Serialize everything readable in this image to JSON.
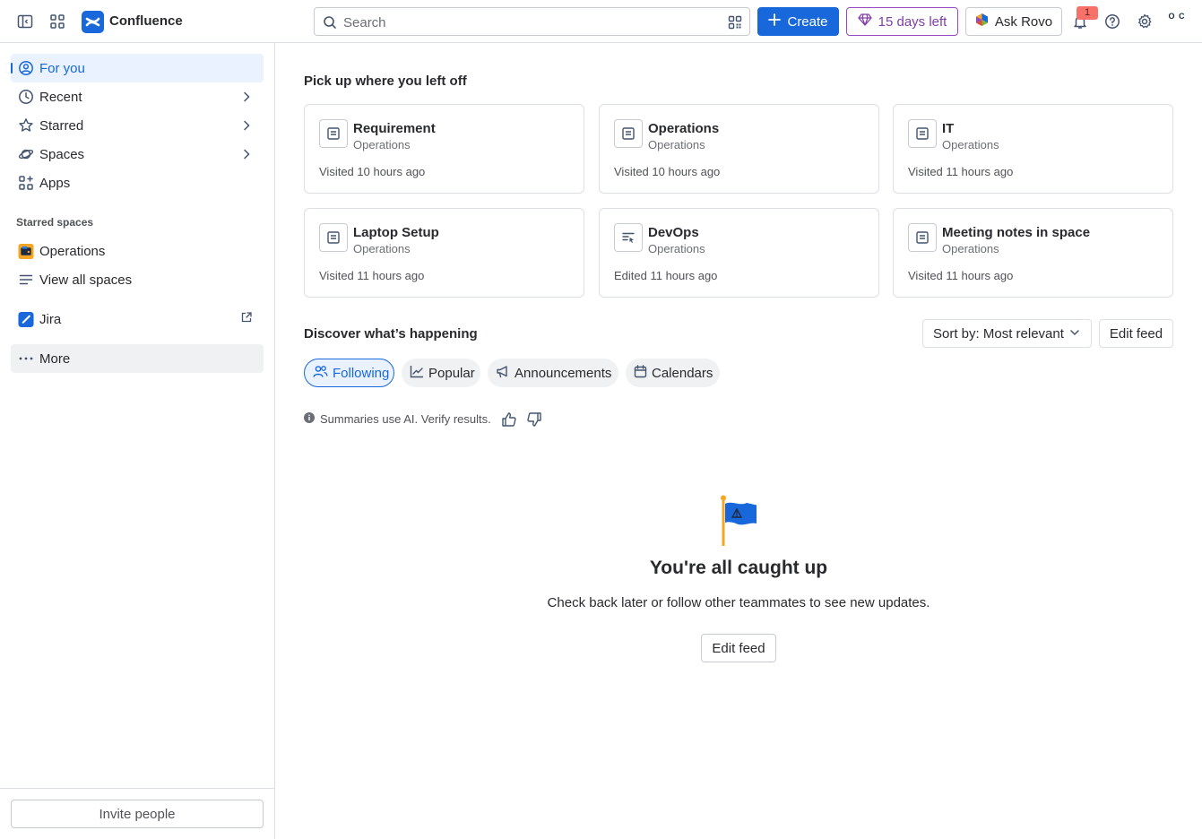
{
  "topbar": {
    "app_name": "Confluence",
    "search_placeholder": "Search",
    "create_label": "Create",
    "trial_label": "15 days left",
    "rovo_label": "Ask Rovo",
    "notification_count": "1",
    "avatar_initials": "O C"
  },
  "sidebar": {
    "items": [
      {
        "label": "For you",
        "icon": "user-circle-icon",
        "active": true
      },
      {
        "label": "Recent",
        "icon": "clock-icon"
      },
      {
        "label": "Starred",
        "icon": "star-icon"
      },
      {
        "label": "Spaces",
        "icon": "planet-icon"
      },
      {
        "label": "Apps",
        "icon": "apps-icon"
      }
    ],
    "starred_spaces_label": "Starred spaces",
    "starred_spaces": [
      {
        "label": "Operations",
        "icon": "operations-space-icon"
      }
    ],
    "view_all_spaces_label": "View all spaces",
    "jira_label": "Jira",
    "more_label": "More",
    "invite_label": "Invite people"
  },
  "main": {
    "recent_heading": "Pick up where you left off",
    "cards": [
      {
        "title": "Requirement",
        "space": "Operations",
        "meta": "Visited 10 hours ago",
        "icon": "page-icon"
      },
      {
        "title": "Operations",
        "space": "Operations",
        "meta": "Visited 10 hours ago",
        "icon": "page-icon"
      },
      {
        "title": "IT",
        "space": "Operations",
        "meta": "Visited 11 hours ago",
        "icon": "page-icon"
      },
      {
        "title": "Laptop Setup",
        "space": "Operations",
        "meta": "Visited 11 hours ago",
        "icon": "page-icon"
      },
      {
        "title": "DevOps",
        "space": "Operations",
        "meta": "Edited 11 hours ago",
        "icon": "live-doc-icon"
      },
      {
        "title": "Meeting notes in space",
        "space": "Operations",
        "meta": "Visited 11 hours ago",
        "icon": "page-icon"
      }
    ],
    "discover_heading": "Discover what’s happening",
    "sort_label": "Sort by: Most relevant",
    "edit_feed_label": "Edit feed",
    "tabs": [
      {
        "label": "Following",
        "icon": "people-icon",
        "selected": true
      },
      {
        "label": "Popular",
        "icon": "trend-icon"
      },
      {
        "label": "Announcements",
        "icon": "megaphone-icon"
      },
      {
        "label": "Calendars",
        "icon": "calendar-icon"
      }
    ],
    "ai_note": "Summaries use AI. Verify results.",
    "empty_title": "You're all caught up",
    "empty_subtitle": "Check back later or follow other teammates to see new updates.",
    "empty_button": "Edit feed"
  },
  "colors": {
    "brand_blue": "#1868db",
    "trial_purple": "#803fa5",
    "badge_red": "#f87168",
    "flag_yellow": "#f5a623"
  }
}
